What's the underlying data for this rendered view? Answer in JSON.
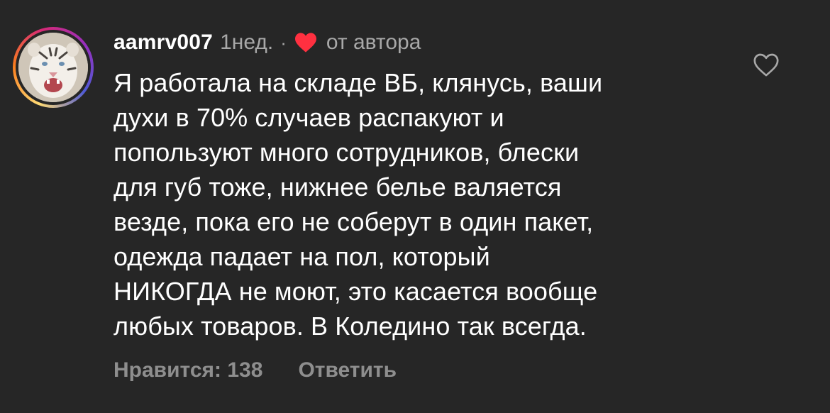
{
  "comment": {
    "username": "aamrv007",
    "time": "1нед.",
    "separator": "·",
    "from_author": "от автора",
    "text": "Я работала на складе ВБ, клянусь, ваши\nдухи в 70% случаев распакуют и\nпопользуют много сотрудников, блески\nдля губ тоже, нижнее белье валяется\nвезде, пока его не соберут в один пакет,\nодежда падает на пол, который\nНИКОГДА не моют, это касается вообще\nлюбых товаров. В Коледино так всегда.",
    "likes_label": "Нравится: 138",
    "reply_label": "Ответить"
  },
  "icons": {
    "author_heart": "heart-filled-icon",
    "like": "heart-outline-icon"
  },
  "colors": {
    "background": "#262626",
    "text": "#ffffff",
    "secondary": "#a8a8a8",
    "author_heart": "#ff3040"
  }
}
